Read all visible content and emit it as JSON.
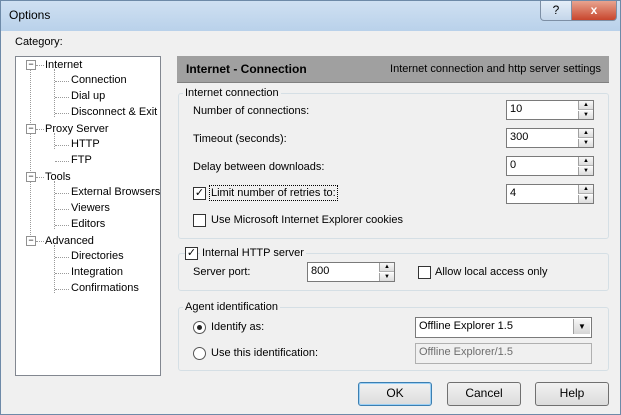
{
  "window": {
    "title": "Options",
    "help_glyph": "?",
    "close_glyph": "x"
  },
  "category": {
    "label": "Category:",
    "tree": [
      {
        "label": "Internet",
        "children": [
          "Connection",
          "Dial up",
          "Disconnect & Exit"
        ]
      },
      {
        "label": "Proxy Server",
        "children": [
          "HTTP",
          "FTP"
        ]
      },
      {
        "label": "Tools",
        "children": [
          "External Browsers",
          "Viewers",
          "Editors"
        ]
      },
      {
        "label": "Advanced",
        "children": [
          "Directories",
          "Integration",
          "Confirmations"
        ]
      }
    ],
    "expand_glyph": "−"
  },
  "header": {
    "title": "Internet - Connection",
    "description": "Internet connection and http server settings"
  },
  "internet_connection": {
    "group_label": "Internet connection",
    "connections_label": "Number of connections:",
    "connections_value": "10",
    "timeout_label": "Timeout (seconds):",
    "timeout_value": "300",
    "delay_label": "Delay between downloads:",
    "delay_value": "0",
    "retries_label": "Limit number of retries to:",
    "retries_value": "4",
    "retries_checked": "✓",
    "ie_cookies_label": "Use Microsoft Internet Explorer cookies",
    "spin_up": "▲",
    "spin_down": "▼"
  },
  "http_server": {
    "group_label": "Internal HTTP server",
    "enabled_mark": "✓",
    "port_label": "Server port:",
    "port_value": "800",
    "local_access_label": "Allow local access only"
  },
  "agent": {
    "group_label": "Agent identification",
    "identify_label": "Identify as:",
    "identify_value": "Offline Explorer 1.5",
    "custom_label": "Use this identification:",
    "custom_value": "Offline Explorer/1.5",
    "dropdown_glyph": "▼"
  },
  "buttons": {
    "ok": "OK",
    "cancel": "Cancel",
    "help": "Help"
  }
}
